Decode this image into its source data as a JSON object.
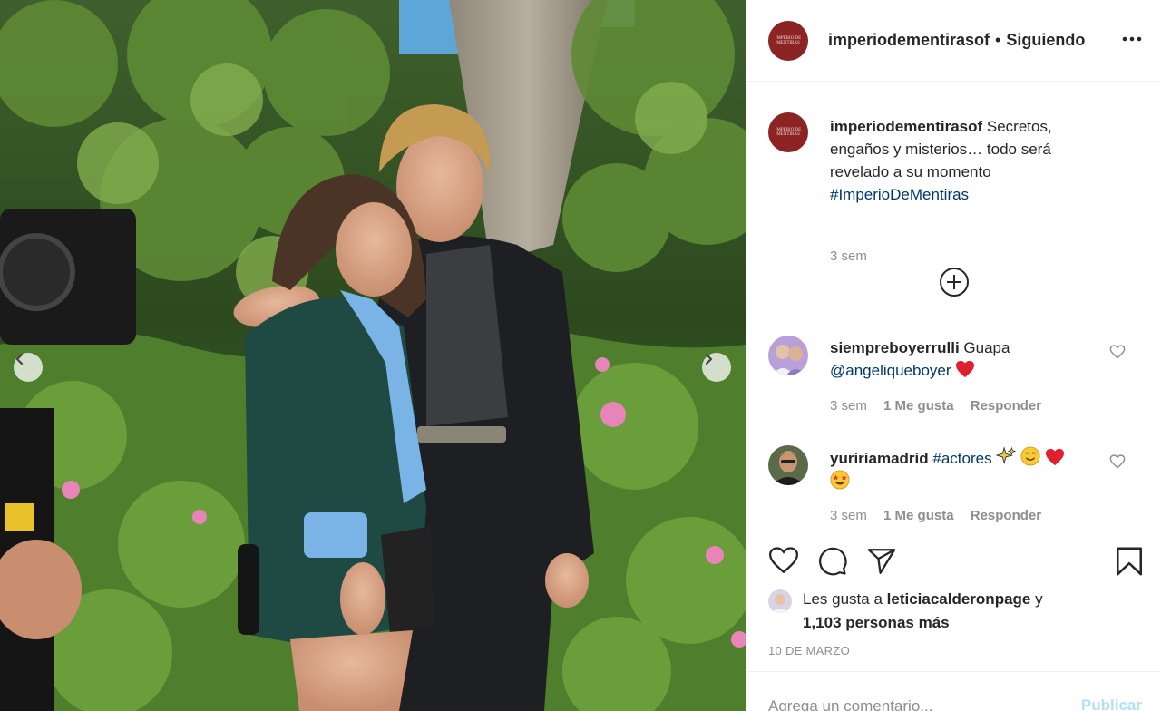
{
  "colors": {
    "accent_blue": "#0095f6",
    "link_blue": "#00376b",
    "muted_gray": "#8e8e8e",
    "brand_red": "#8c2424",
    "heart_red": "#ed4956"
  },
  "post": {
    "header": {
      "username": "imperiodementirasof",
      "separator": "•",
      "follow_status": "Siguiendo",
      "logo_text": "IMPERIO DE MENTIRAS",
      "more_icon": "more-horizontal-icon"
    },
    "photo_nav": {
      "prev_icon": "chevron-left-icon",
      "next_icon": "chevron-right-icon"
    },
    "caption": {
      "username": "imperiodementirasof",
      "text": "Secretos, engaños y misterios… todo será revelado a su momento",
      "hashtag": "#ImperioDeMentiras",
      "time": "3 sem"
    },
    "load_more_icon": "plus-circle-icon",
    "comments": [
      {
        "username": "siempreboyerrulli",
        "text": "Guapa",
        "mention": "@angeliqueboyer",
        "emoji": "red-heart",
        "time": "3 sem",
        "likes": "1 Me gusta",
        "reply": "Responder"
      },
      {
        "username": "yuririamadrid",
        "hashtag": "#actores",
        "emoji": "sparkles, smiling face, red heart, star-struck",
        "time": "3 sem",
        "likes": "1 Me gusta",
        "reply": "Responder"
      }
    ],
    "actions": {
      "like_icon": "heart-icon",
      "comment_icon": "comment-icon",
      "share_icon": "send-icon",
      "save_icon": "bookmark-icon"
    },
    "likes": {
      "prefix": "Les gusta a",
      "user": "leticiacalderonpage",
      "conjunction": "y",
      "others": "1,103 personas más"
    },
    "date": "10 DE MARZO",
    "add_comment": {
      "placeholder": "Agrega un comentario...",
      "publish_label": "Publicar"
    }
  }
}
